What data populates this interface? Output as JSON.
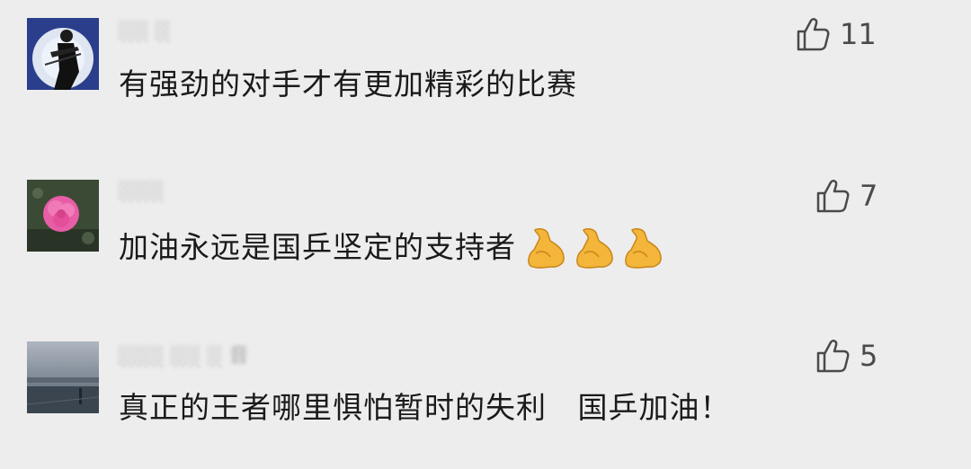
{
  "comments": [
    {
      "username": "░░ ░",
      "text": "有强劲的对手才有更加精彩的比赛",
      "likes": "11",
      "avatar_icon": "person-violin-avatar"
    },
    {
      "username": "░░░",
      "text": "加油永远是国乒坚定的支持者",
      "likes": "7",
      "emoji": [
        "flexed-biceps-icon",
        "flexed-biceps-icon",
        "flexed-biceps-icon"
      ],
      "avatar_icon": "pink-flower-avatar"
    },
    {
      "username": "░░░ ░░ ░ 音",
      "text": "真正的王者哪里惧怕暂时的失利   国乒加油！",
      "likes": "5",
      "avatar_icon": "lake-landscape-avatar"
    }
  ],
  "colors": {
    "background": "#ededed",
    "text": "#1a1a1a",
    "like": "#4a4a4a"
  }
}
